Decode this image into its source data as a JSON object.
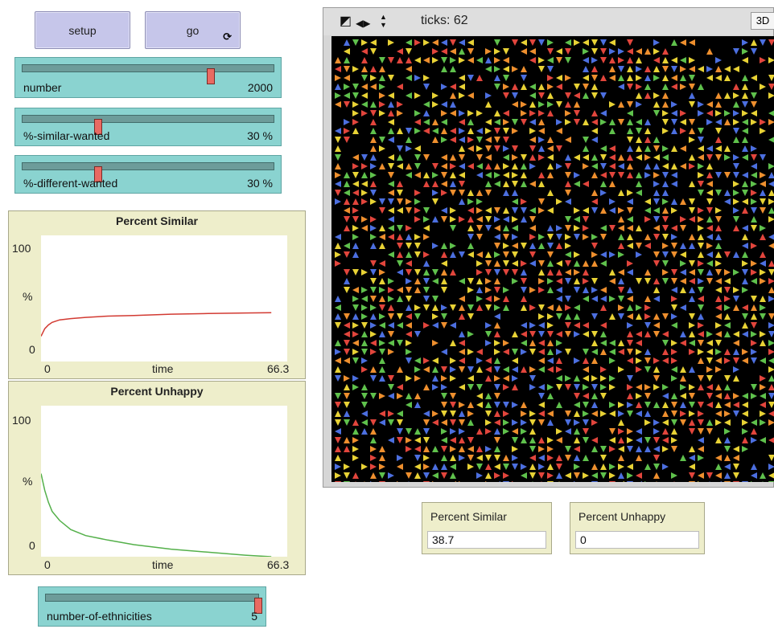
{
  "buttons": {
    "setup": "setup",
    "go": "go",
    "forever_glyph": "⟳"
  },
  "sliders": {
    "number": {
      "label": "number",
      "value": "2000",
      "fraction": 0.75
    },
    "similar": {
      "label": "%-similar-wanted",
      "value": "30 %",
      "fraction": 0.3
    },
    "different": {
      "label": "%-different-wanted",
      "value": "30 %",
      "fraction": 0.3
    },
    "ethnicities": {
      "label": "number-of-ethnicities",
      "value": "5",
      "fraction": 1.0
    }
  },
  "plots": {
    "similar": {
      "title": "Percent Similar",
      "ymax": "100",
      "ylabel": "%",
      "ymin": "0",
      "xmin": "0",
      "xlabel": "time",
      "xmax": "66.3",
      "line_color": "#d23a32"
    },
    "unhappy": {
      "title": "Percent Unhappy",
      "ymax": "100",
      "ylabel": "%",
      "ymin": "0",
      "xmin": "0",
      "xlabel": "time",
      "xmax": "66.3",
      "line_color": "#54b04a"
    }
  },
  "view": {
    "ticks": "ticks: 62",
    "three_d": "3D",
    "icons": {
      "pin": "◩",
      "lr": "◀▶",
      "ud": "▲▼"
    },
    "turtle_colors": [
      "#e2453c",
      "#4c6fe0",
      "#5fc14c",
      "#e8d235",
      "#ee8f2e"
    ]
  },
  "monitors": {
    "similar": {
      "label": "Percent Similar",
      "value": "38.7"
    },
    "unhappy": {
      "label": "Percent Unhappy",
      "value": "0"
    }
  },
  "chart_data": [
    {
      "type": "line",
      "title": "Percent Similar",
      "xlabel": "time",
      "ylabel": "%",
      "xlim": [
        0,
        66.3
      ],
      "ylim": [
        0,
        100
      ],
      "series": [
        {
          "values_x": [
            0,
            1,
            2,
            3,
            5,
            8,
            12,
            18,
            25,
            35,
            45,
            55,
            62
          ],
          "values_y": [
            20,
            26,
            29,
            31,
            33,
            34,
            35,
            36,
            36.5,
            37.5,
            38,
            38.5,
            38.7
          ]
        }
      ]
    },
    {
      "type": "line",
      "title": "Percent Unhappy",
      "xlabel": "time",
      "ylabel": "%",
      "xlim": [
        0,
        66.3
      ],
      "ylim": [
        0,
        100
      ],
      "series": [
        {
          "values_x": [
            0,
            1,
            2,
            3,
            5,
            8,
            12,
            18,
            25,
            35,
            45,
            55,
            62
          ],
          "values_y": [
            55,
            44,
            36,
            30,
            24,
            18,
            14,
            11,
            8,
            5,
            3,
            1,
            0
          ]
        }
      ]
    }
  ]
}
